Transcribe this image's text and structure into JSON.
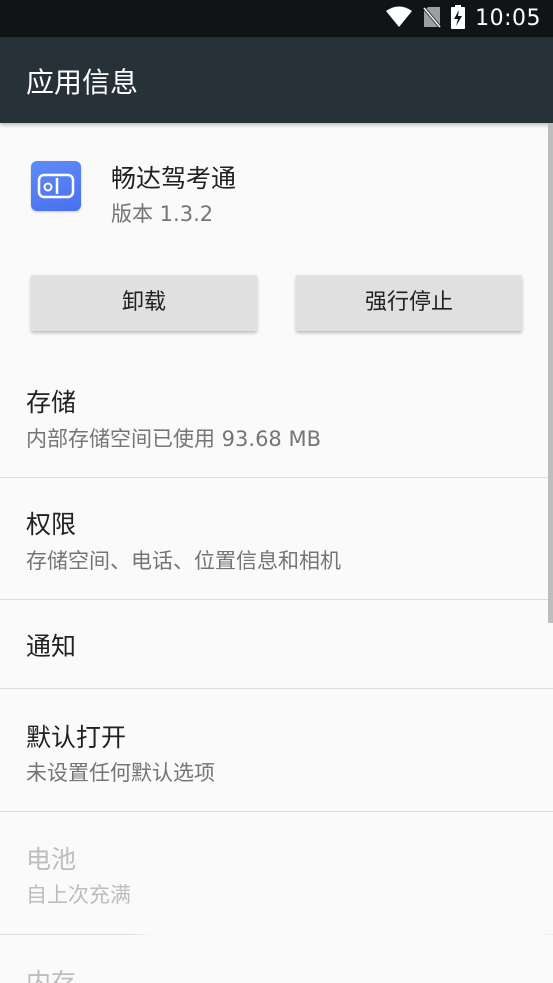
{
  "status_bar": {
    "time": "10:05",
    "icons": [
      "wifi-icon",
      "no-sim-icon",
      "battery-charging-icon"
    ]
  },
  "app_bar": {
    "title": "应用信息"
  },
  "app": {
    "name": "畅达驾考通",
    "version": "版本 1.3.2",
    "icon": "app-icon"
  },
  "buttons": {
    "uninstall": "卸载",
    "force_stop": "强行停止"
  },
  "items": [
    {
      "title": "存储",
      "subtitle": "内部存储空间已使用 93.68 MB"
    },
    {
      "title": "权限",
      "subtitle": "存储空间、电话、位置信息和相机"
    },
    {
      "title": "通知",
      "subtitle": ""
    },
    {
      "title": "默认打开",
      "subtitle": "未设置任何默认选项"
    },
    {
      "title": "电池",
      "subtitle": "自上次充满"
    },
    {
      "title": "内存",
      "subtitle": ""
    }
  ],
  "colors": {
    "status_bar": "#111417",
    "app_bar": "#263238",
    "background": "#fafafa",
    "button": "#e0e0e0"
  }
}
